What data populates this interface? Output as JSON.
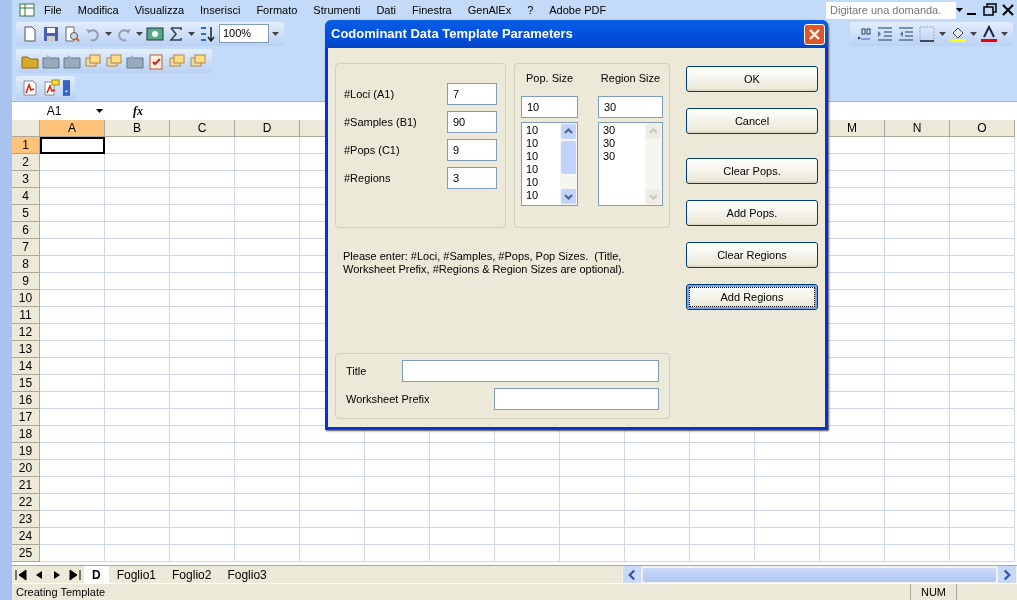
{
  "menu_bar": {
    "items": [
      "File",
      "Modifica",
      "Visualizza",
      "Inserisci",
      "Formato",
      "Strumenti",
      "Dati",
      "Finestra",
      "GenAlEx",
      "?",
      "Adobe PDF"
    ],
    "help_placeholder": "Digitare una domanda."
  },
  "toolbar": {
    "zoom": "100%"
  },
  "formula_bar": {
    "name_box": "A1",
    "function_label": "fx"
  },
  "sheet": {
    "columns_left": [
      {
        "label": "A",
        "selected": true
      },
      {
        "label": "B",
        "selected": false
      },
      {
        "label": "C",
        "selected": false
      },
      {
        "label": "D",
        "selected": false
      }
    ],
    "columns_right": [
      {
        "label": "M",
        "selected": false
      },
      {
        "label": "N",
        "selected": false
      },
      {
        "label": "O",
        "selected": false
      }
    ],
    "rows": [
      {
        "label": "1",
        "selected": true
      },
      {
        "label": "2",
        "selected": false
      },
      {
        "label": "3",
        "selected": false
      },
      {
        "label": "4",
        "selected": false
      },
      {
        "label": "5",
        "selected": false
      },
      {
        "label": "6",
        "selected": false
      },
      {
        "label": "7",
        "selected": false
      },
      {
        "label": "8",
        "selected": false
      },
      {
        "label": "9",
        "selected": false
      },
      {
        "label": "10",
        "selected": false
      },
      {
        "label": "11",
        "selected": false
      },
      {
        "label": "12",
        "selected": false
      },
      {
        "label": "13",
        "selected": false
      },
      {
        "label": "14",
        "selected": false
      },
      {
        "label": "15",
        "selected": false
      },
      {
        "label": "16",
        "selected": false
      },
      {
        "label": "17",
        "selected": false
      },
      {
        "label": "18",
        "selected": false
      },
      {
        "label": "19",
        "selected": false
      },
      {
        "label": "20",
        "selected": false
      },
      {
        "label": "21",
        "selected": false
      },
      {
        "label": "22",
        "selected": false
      },
      {
        "label": "23",
        "selected": false
      },
      {
        "label": "24",
        "selected": false
      },
      {
        "label": "25",
        "selected": false
      }
    ]
  },
  "sheet_tabs": [
    {
      "label": "D",
      "selected": true
    },
    {
      "label": "Foglio1",
      "selected": false
    },
    {
      "label": "Foglio2",
      "selected": false
    },
    {
      "label": "Foglio3",
      "selected": false
    }
  ],
  "status_bar": {
    "message": "Creating Template",
    "indicators": [
      "NUM"
    ]
  },
  "dialog": {
    "title": "Codominant Data Template Parameters",
    "fields": [
      {
        "label": "#Loci (A1)",
        "value": "7"
      },
      {
        "label": "#Samples (B1)",
        "value": "90"
      },
      {
        "label": "#Pops (C1)",
        "value": "9"
      },
      {
        "label": "#Regions",
        "value": "3"
      }
    ],
    "pop_size": {
      "heading": "Pop. Size",
      "value": "10",
      "list": [
        "10",
        "10",
        "10",
        "10",
        "10",
        "10"
      ]
    },
    "region_size": {
      "heading": "Region Size",
      "value": "30",
      "list": [
        "30",
        "30",
        "30"
      ]
    },
    "note": "Please enter: #Loci, #Samples, #Pops, Pop Sizes.  (Title, Worksheet Prefix, #Regions & Region Sizes are optional).",
    "text_fields": [
      {
        "label": "Title"
      },
      {
        "label": "Worksheet Prefix"
      }
    ],
    "buttons": [
      {
        "label": "OK",
        "focused": false
      },
      {
        "label": "Cancel",
        "focused": false
      },
      {
        "label": "Clear Pops.",
        "focused": false
      },
      {
        "label": "Add Pops.",
        "focused": false
      },
      {
        "label": "Clear Regions",
        "focused": false
      },
      {
        "label": "Add Regions",
        "focused": true
      }
    ]
  }
}
